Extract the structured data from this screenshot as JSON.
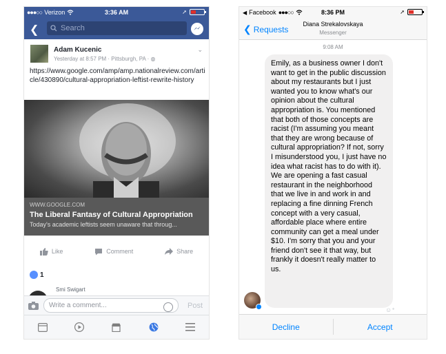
{
  "facebook": {
    "status": {
      "carrier": "Verizon",
      "time": "3:36 AM"
    },
    "search": {
      "placeholder": "Search"
    },
    "post": {
      "author": "Adam Kucenic",
      "meta": "Yesterday at 8:57 PM · Pittsburgh, PA · ",
      "text": "https://www.google.com/amp/amp.nationalreview.com/article/430890/cultural-appropriation-leftist-rewrite-history",
      "link": {
        "source": "WWW.GOOGLE.COM",
        "title": "The Liberal Fantasy of Cultural Appropriation",
        "description": "Today's academic leftists seem unaware that throug..."
      },
      "actions": {
        "like": "Like",
        "comment": "Comment",
        "share": "Share"
      },
      "like_count": "1",
      "commenter": "Smi Swigart"
    },
    "compose": {
      "placeholder": "Write a comment...",
      "post_label": "Post"
    },
    "tabbar_icons": [
      "news-feed-icon",
      "video-icon",
      "marketplace-icon",
      "globe-icon",
      "menu-icon"
    ]
  },
  "messenger": {
    "status": {
      "app": "Facebook",
      "time": "8:36 PM"
    },
    "header": {
      "back_label": "Requests",
      "name": "Diana Strekalovskaya",
      "subtitle": "Messenger"
    },
    "timestamp": "9:08 AM",
    "message": "Emily, as a business owner I don't want to get in the public discussion about my restaurants but I just wanted you to know what's our opinion about the cultural appropriation is. You mentioned that both of those concepts are racist (I'm assuming you meant that they are wrong because of cultural appropriation? If not, sorry I misunderstood you, I just have no idea what racist has to do with it). We are opening a fast casual restaurant in the neighborhood that we live in and work in and replacing a fine dinning French concept with a very casual, affordable place where entire community can get a meal under $10. I'm sorry that you and your friend don't see it that way, but frankly it doesn't really matter to us.",
    "decline_label": "Decline",
    "accept_label": "Accept",
    "accent_color": "#0084ff"
  }
}
